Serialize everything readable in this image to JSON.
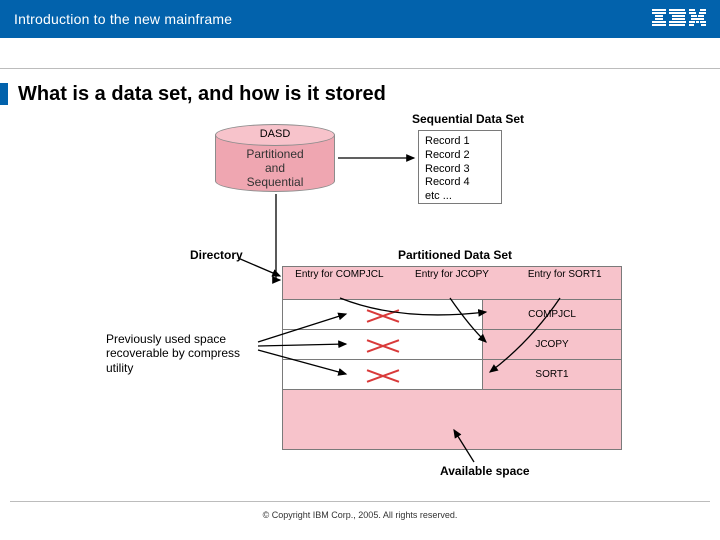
{
  "header": {
    "title": "Introduction to the new mainframe",
    "logo": "IBM"
  },
  "slide": {
    "title": "What is a data set, and how is it stored"
  },
  "diagram": {
    "dasd": {
      "label": "DASD",
      "text_line1": "Partitioned",
      "text_line2": "and",
      "text_line3": "Sequential"
    },
    "sequential": {
      "title": "Sequential Data Set",
      "rows": [
        "Record 1",
        "Record 2",
        "Record 3",
        "Record 4",
        "etc ..."
      ]
    },
    "directory_label": "Directory",
    "partitioned": {
      "title": "Partitioned Data Set",
      "entries": [
        "Entry for COMPJCL",
        "Entry for JCOPY",
        "Entry for SORT1"
      ],
      "members": [
        "COMPJCL",
        "JCOPY",
        "SORT1"
      ]
    },
    "prev_label_line1": "Previously used space",
    "prev_label_line2": "recoverable by compress utility",
    "available_label": "Available space"
  },
  "footer": {
    "copyright": "© Copyright IBM Corp., 2005. All rights reserved."
  }
}
